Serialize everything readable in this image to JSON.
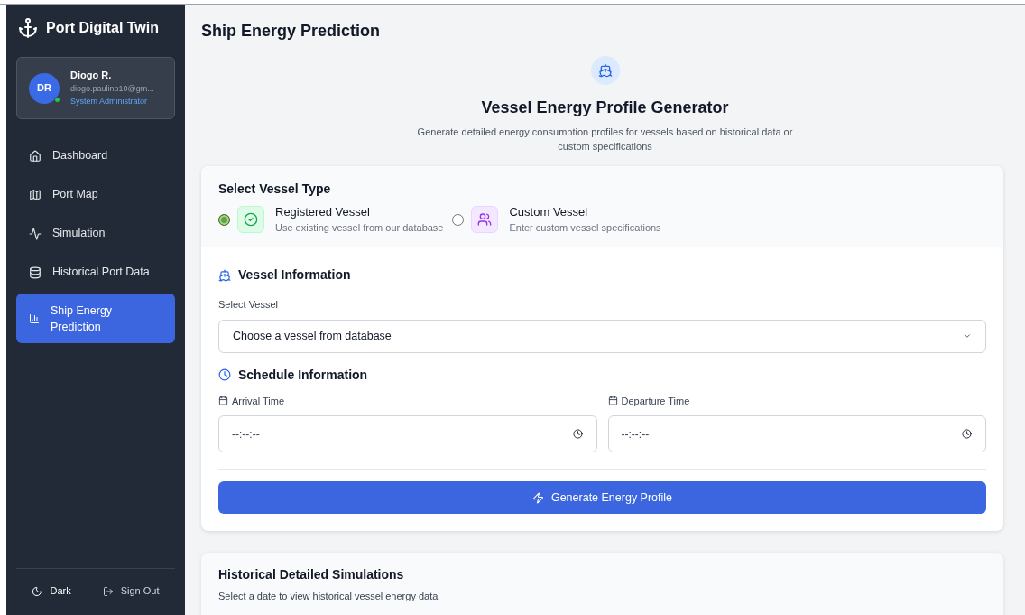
{
  "app": {
    "title": "Port Digital Twin"
  },
  "user": {
    "initials": "DR",
    "name": "Diogo R.",
    "email": "diogo.paulino10@gm...",
    "role": "System Administrator",
    "online": true
  },
  "nav": [
    {
      "label": "Dashboard",
      "selected": false
    },
    {
      "label": "Port Map",
      "selected": false
    },
    {
      "label": "Simulation",
      "selected": false
    },
    {
      "label": "Historical Port Data",
      "selected": false
    },
    {
      "label": "Ship Energy Prediction",
      "selected": true
    }
  ],
  "footer": {
    "theme": "Dark",
    "signout": "Sign Out"
  },
  "page_title": "Ship Energy Prediction",
  "hero": {
    "title": "Vessel Energy Profile Generator",
    "subtitle": "Generate detailed energy consumption profiles for vessels based on historical data or custom specifications"
  },
  "vessel_type": {
    "heading": "Select Vessel Type",
    "options": [
      {
        "kind": "registered",
        "title": "Registered Vessel",
        "description": "Use existing vessel from our database",
        "selected": true
      },
      {
        "kind": "custom",
        "title": "Custom Vessel",
        "description": "Enter custom vessel specifications",
        "selected": false
      }
    ]
  },
  "vessel_info": {
    "heading": "Vessel Information",
    "label": "Select Vessel",
    "value": "Choose a vessel from database"
  },
  "schedule": {
    "heading": "Schedule Information",
    "fields": [
      {
        "label": "Arrival Time",
        "placeholder": "--:--:--"
      },
      {
        "label": "Departure Time",
        "placeholder": "--:--:--"
      }
    ]
  },
  "generate_button": "Generate Energy Profile",
  "historical": {
    "title": "Historical Detailed Simulations",
    "subtitle": "Select a date to view historical vessel energy data"
  }
}
